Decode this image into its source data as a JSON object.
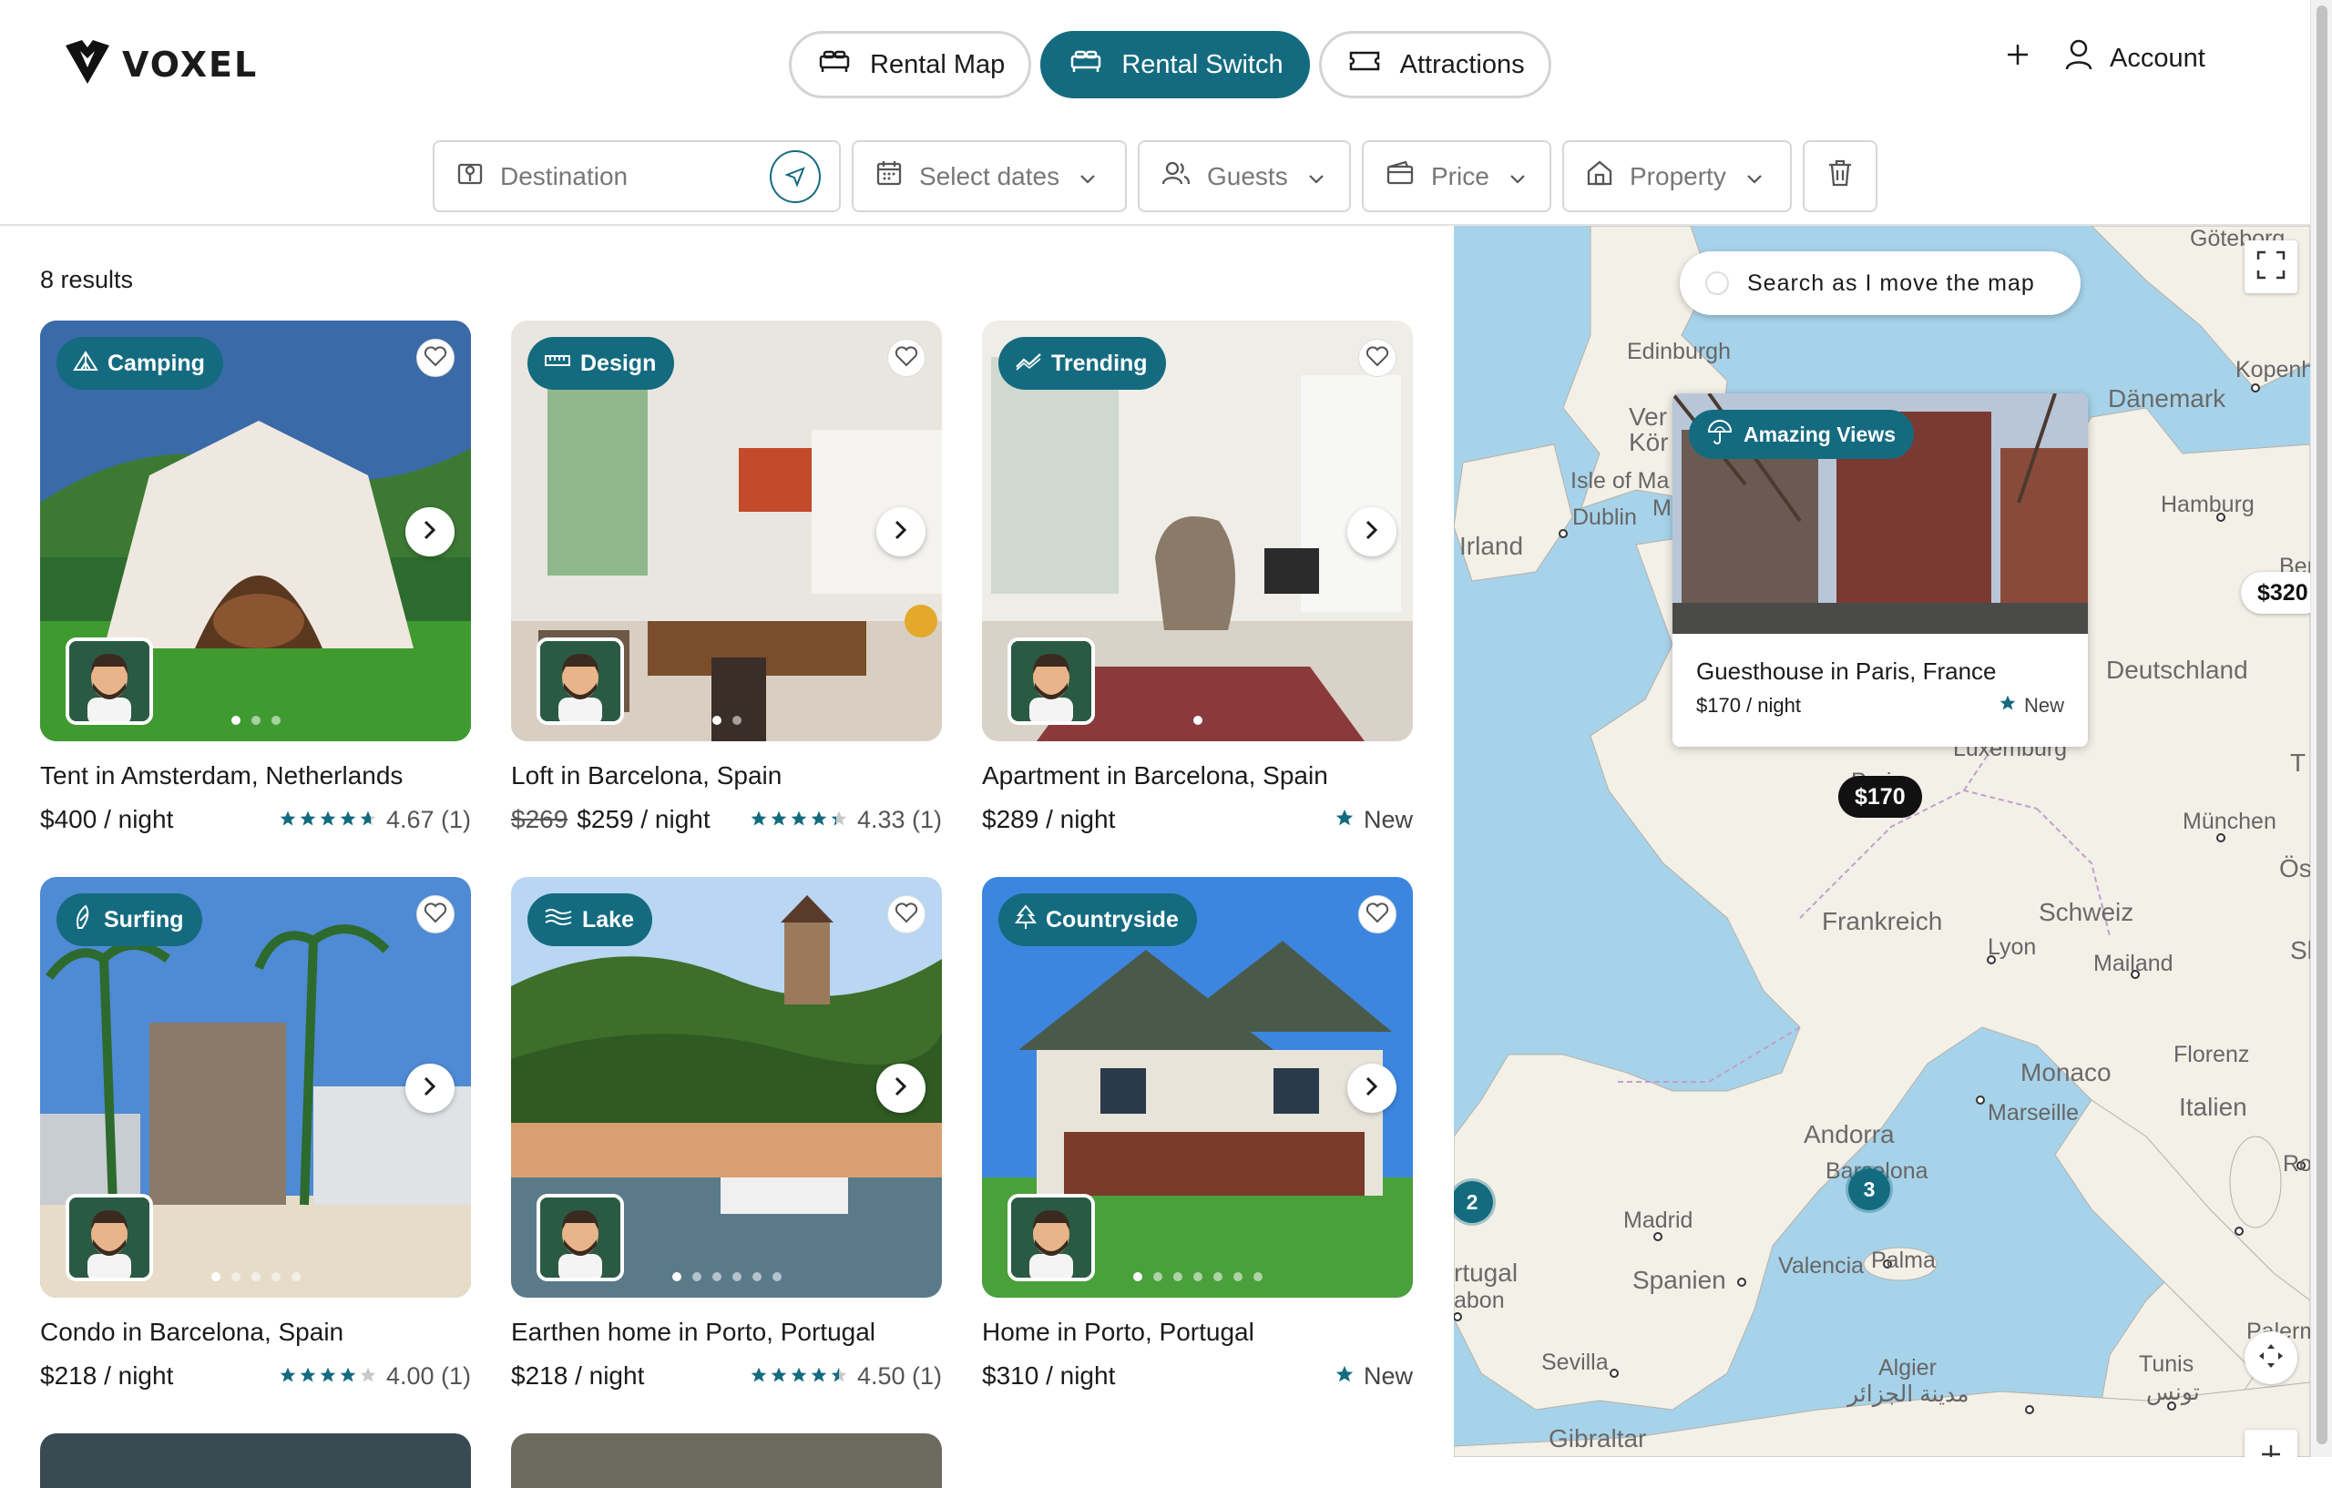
{
  "brand": {
    "name": "VOXEL"
  },
  "nav": {
    "tabs": [
      {
        "label": "Rental Map",
        "icon": "bed-icon",
        "active": false
      },
      {
        "label": "Rental Switch",
        "icon": "bed-icon",
        "active": true
      },
      {
        "label": "Attractions",
        "icon": "ticket-icon",
        "active": false
      }
    ],
    "account_label": "Account"
  },
  "filters": {
    "destination_placeholder": "Destination",
    "dates_label": "Select dates",
    "guests_label": "Guests",
    "price_label": "Price",
    "property_label": "Property"
  },
  "results": {
    "count_label": "8 results"
  },
  "listings": [
    {
      "title": "Tent in Amsterdam, Netherlands",
      "tag": "Camping",
      "tag_icon": "tent-icon",
      "price": "$400 / night",
      "old_price": "",
      "rating_text": "4.67 (1)",
      "rating": 4.67,
      "is_new": false,
      "new_label": "",
      "photos": 3,
      "current_photo": 0
    },
    {
      "title": "Loft in Barcelona, Spain",
      "tag": "Design",
      "tag_icon": "ruler-icon",
      "price": "$259 / night",
      "old_price": "$269",
      "rating_text": "4.33 (1)",
      "rating": 4.33,
      "is_new": false,
      "new_label": "",
      "photos": 2,
      "current_photo": 0
    },
    {
      "title": "Apartment in Barcelona, Spain",
      "tag": "Trending",
      "tag_icon": "trending-icon",
      "price": "$289 / night",
      "old_price": "",
      "rating_text": "",
      "rating": 0,
      "is_new": true,
      "new_label": "New",
      "photos": 1,
      "current_photo": 0
    },
    {
      "title": "Condo in Barcelona, Spain",
      "tag": "Surfing",
      "tag_icon": "surf-icon",
      "price": "$218 / night",
      "old_price": "",
      "rating_text": "4.00 (1)",
      "rating": 4.0,
      "is_new": false,
      "new_label": "",
      "photos": 5,
      "current_photo": 0
    },
    {
      "title": "Earthen home in Porto, Portugal",
      "tag": "Lake",
      "tag_icon": "waves-icon",
      "price": "$218 / night",
      "old_price": "",
      "rating_text": "4.50 (1)",
      "rating": 4.5,
      "is_new": false,
      "new_label": "",
      "photos": 6,
      "current_photo": 0
    },
    {
      "title": "Home in Porto, Portugal",
      "tag": "Countryside",
      "tag_icon": "tree-icon",
      "price": "$310 / night",
      "old_price": "",
      "rating_text": "",
      "rating": 0,
      "is_new": true,
      "new_label": "New",
      "photos": 7,
      "current_photo": 0
    }
  ],
  "map": {
    "search_toggle_label": "Search as I move the map",
    "popup": {
      "tag": "Amazing Views",
      "title": "Guesthouse in Paris, France",
      "price": "$170 / night",
      "new_label": "New"
    },
    "pins": [
      {
        "label": "$170"
      },
      {
        "label": "$320"
      }
    ],
    "clusters": [
      {
        "count": "2"
      },
      {
        "count": "3"
      }
    ],
    "labels": {
      "goteborg": "Göteborg",
      "edinburgh": "Edinburgh",
      "kopenhagen": "Kopenhage",
      "danemark": "Dänemark",
      "vereinigtes": "Ver",
      "konigreich": "Kör",
      "isle_of_man": "Isle of Ma",
      "man_tail": "M",
      "dublin": "Dublin",
      "irland": "Irland",
      "hamburg": "Hamburg",
      "berlin": "Berli",
      "deutschland": "Deutschland",
      "luxemburg": "Luxemburg",
      "paris": "Paris",
      "munchen": "München",
      "osterreich": "Öste",
      "frankreich": "Frankreich",
      "schweiz": "Schweiz",
      "lyon": "Lyon",
      "mailand": "Mailand",
      "slovenia": "Slc",
      "florenz": "Florenz",
      "monaco": "Monaco",
      "marseille": "Marseille",
      "italien": "Italien",
      "rom": "Rom",
      "andorra": "Andorra",
      "barcelona": "Barcelona",
      "madrid": "Madrid",
      "portugal": "rtugal",
      "lisbon": "abon",
      "spanien": "Spanien",
      "valencia": "Valencia",
      "palma": "Palma",
      "palermo": "Palerm",
      "sevilla": "Sevilla",
      "algier": "Algier",
      "algier_ar": "مدينة الجزائر",
      "tunis": "Tunis",
      "tunis_ar": "تونس",
      "gibraltar": "Gibraltar",
      "t_edge": "T"
    }
  },
  "colors": {
    "accent": "#146b80",
    "star": "#146b80",
    "map_water": "#a7d3ea",
    "map_land": "#f3f0e8"
  }
}
